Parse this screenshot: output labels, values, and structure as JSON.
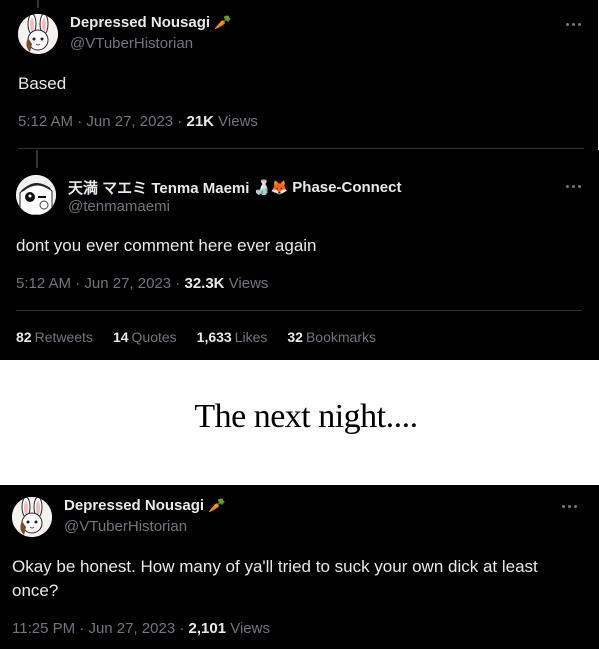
{
  "tweets": [
    {
      "display_name": "Depressed Nousagi",
      "name_emoji": "🥕",
      "handle": "@VTuberHistorian",
      "text": "Based",
      "time": "5:12 AM",
      "sep1": " · ",
      "date": "Jun 27, 2023",
      "sep2": " · ",
      "views_count": "21K",
      "views_label": " Views"
    },
    {
      "display_name": "天満 マエミ Tenma Maemi",
      "name_emoji": "🍶🦊",
      "name_suffix": "Phase-Connect",
      "handle": "@tenmamaemi",
      "text": "dont you ever comment here ever again",
      "time": "5:12 AM",
      "sep1": " · ",
      "date": "Jun 27, 2023",
      "sep2": " · ",
      "views_count": "32.3K",
      "views_label": " Views",
      "stats": [
        {
          "count": "82",
          "label": "Retweets"
        },
        {
          "count": "14",
          "label": "Quotes"
        },
        {
          "count": "1,633",
          "label": "Likes"
        },
        {
          "count": "32",
          "label": "Bookmarks"
        }
      ]
    },
    {
      "display_name": "Depressed Nousagi",
      "name_emoji": "🥕",
      "handle": "@VTuberHistorian",
      "text": "Okay be honest. How many of ya'll tried to suck your own dick at least once?",
      "time": "11:25 PM",
      "sep1": " · ",
      "date": "Jun 27, 2023",
      "sep2": " · ",
      "views_count": "2,101",
      "views_label": " Views"
    }
  ],
  "caption": "The next night....",
  "colors": {
    "background": "#000000",
    "text": "#e7e9ea",
    "muted": "#71767b",
    "divider": "#2f3336",
    "caption_bg": "#ffffff"
  },
  "icons": {
    "more": "more-horizontal-icon",
    "avatar_1": "bunny-avatar",
    "avatar_2": "tenma-avatar"
  }
}
